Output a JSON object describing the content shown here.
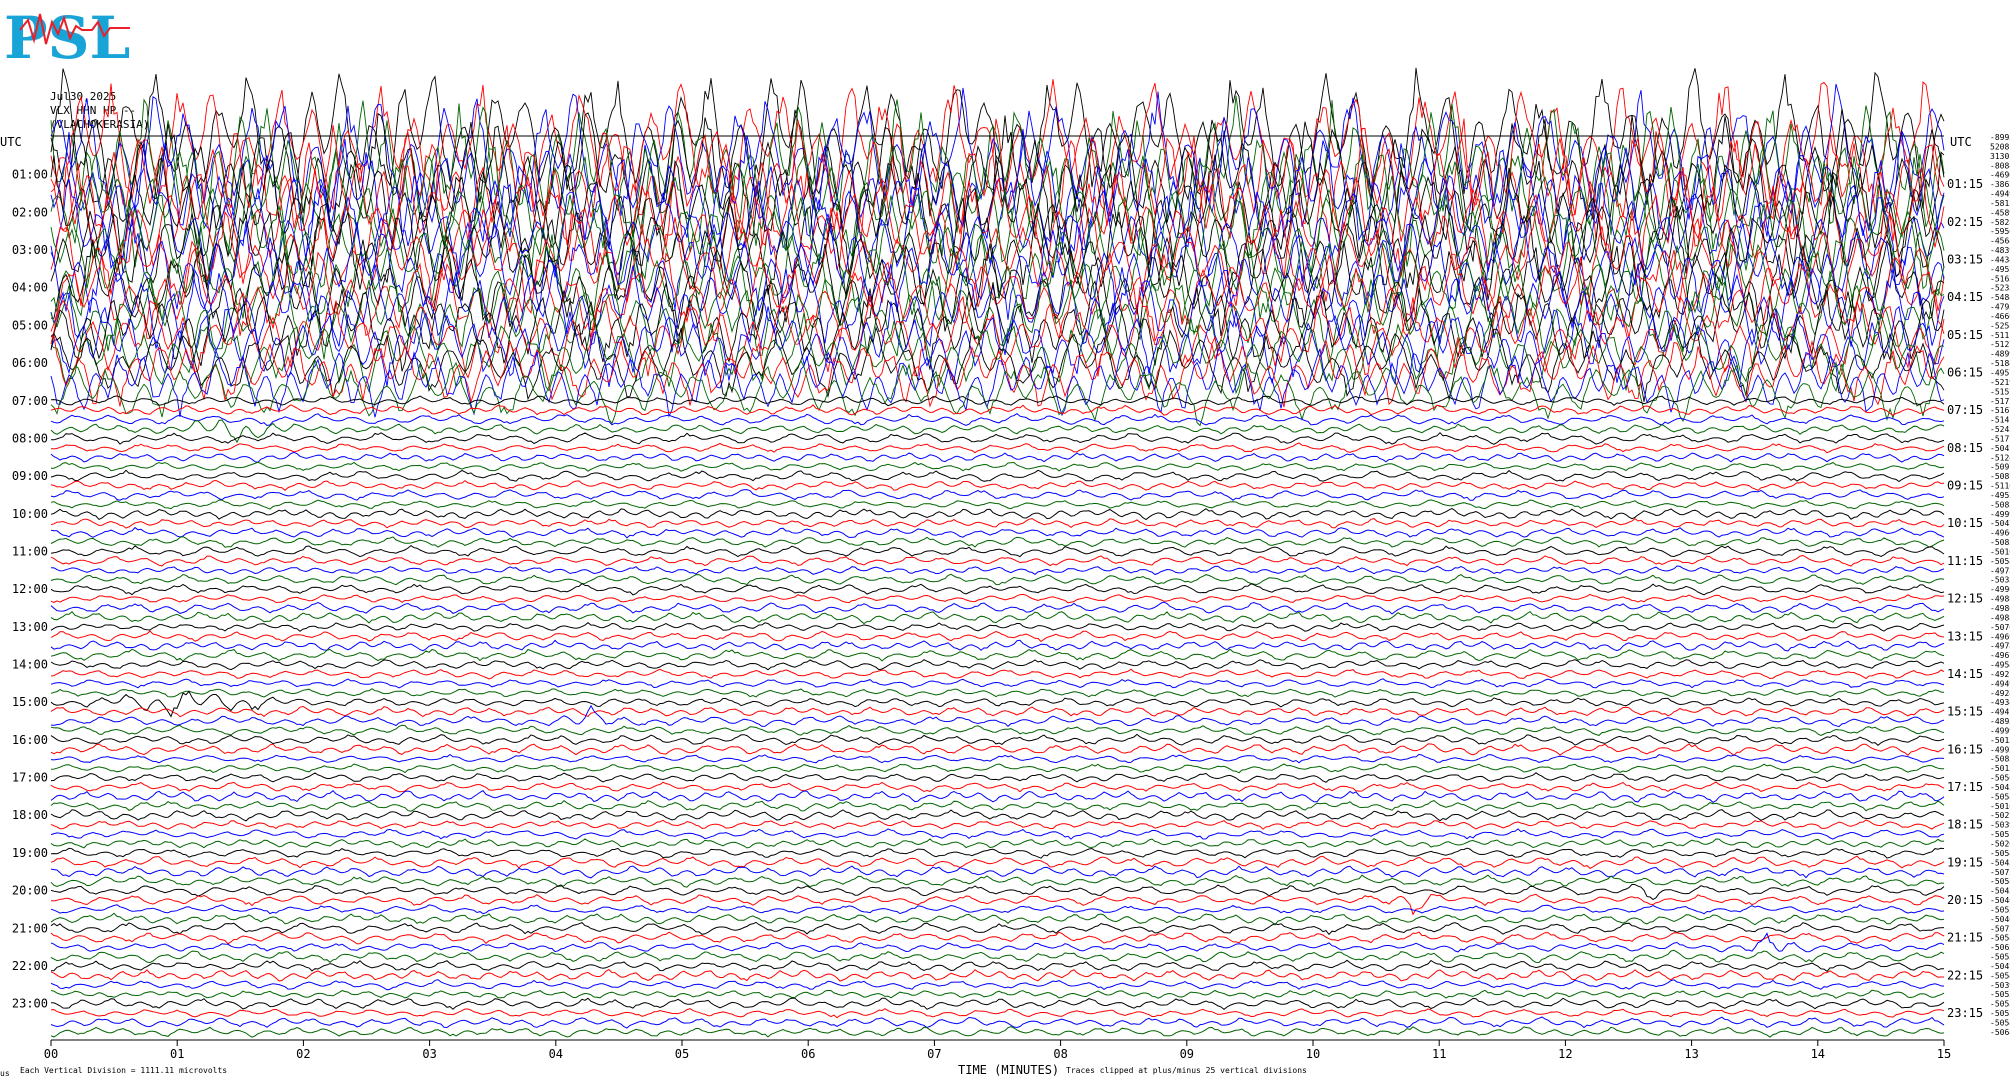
{
  "header": {
    "logo_text": "PSL",
    "date": "Jul30,2025",
    "channel": "VLX HHN HP --",
    "station": "(VLACHOKERASIA)"
  },
  "axis": {
    "left_title": "UTC",
    "right_title": "UTC",
    "x_title": "TIME (MINUTES)",
    "scale_note": "Each Vertical Division = 1111.11 microvolts",
    "clip_note": "Traces clipped at plus/minus 25 vertical divisions",
    "corner_mark": "us"
  },
  "colors": {
    "trace_cycle": [
      "#000000",
      "#ff0000",
      "#0000ff",
      "#006400"
    ],
    "logo_cyan": "#19a4d8",
    "logo_red": "#e8202a"
  },
  "chart_data": {
    "type": "line",
    "title": "",
    "xlabel": "TIME (MINUTES)",
    "x_ticks": [
      "00",
      "01",
      "02",
      "03",
      "04",
      "05",
      "06",
      "07",
      "08",
      "09",
      "10",
      "11",
      "12",
      "13",
      "14",
      "15"
    ],
    "xlim": [
      0,
      15
    ],
    "left_ticks": [
      "01:00",
      "02:00",
      "03:00",
      "04:00",
      "05:00",
      "06:00",
      "07:00",
      "08:00",
      "09:00",
      "10:00",
      "11:00",
      "12:00",
      "13:00",
      "14:00",
      "15:00",
      "16:00",
      "17:00",
      "18:00",
      "19:00",
      "20:00",
      "21:00",
      "22:00",
      "23:00"
    ],
    "right_ticks": [
      "01:15",
      "02:15",
      "03:15",
      "04:15",
      "05:15",
      "06:15",
      "07:15",
      "08:15",
      "09:15",
      "10:15",
      "11:15",
      "12:15",
      "13:15",
      "14:15",
      "15:15",
      "16:15",
      "17:15",
      "18:15",
      "19:15",
      "20:15",
      "21:15",
      "22:15",
      "23:15"
    ],
    "trace_count": 96,
    "trace_minutes": 15,
    "clipped_rows": "00:00-06:45",
    "right_values": [
      "-8995",
      "5208",
      "3130",
      "-8084",
      "-4696",
      "-3862",
      "-4949",
      "-5812",
      "-4589",
      "-5828",
      "-5950",
      "-4564",
      "-4839",
      "-4434",
      "-4952",
      "-5163",
      "-5233",
      "-5484",
      "-4793",
      "-4660",
      "-5255",
      "-5111",
      "-5127",
      "-4899",
      "-5184",
      "-4957",
      "-5219",
      "-5157",
      "-5172",
      "-5167",
      "-5141",
      "-5245",
      "-5177",
      "-5047",
      "-5124",
      "-5097",
      "-5087",
      "-5116",
      "-4952",
      "-5082",
      "-4999",
      "-5047",
      "-4960",
      "-5085",
      "-5010",
      "-5058",
      "-4975",
      "-5033",
      "-4996",
      "-4988",
      "-4986",
      "-4988",
      "-5076",
      "-4969",
      "-4978",
      "-4967",
      "-4954",
      "-4921",
      "-4949",
      "-4924",
      "-4934",
      "-4941",
      "-4895",
      "-4999",
      "-5013",
      "-4992",
      "-5085",
      "-5013",
      "-5056",
      "-5045",
      "-5058",
      "-5010",
      "-5027",
      "-5039",
      "-5051",
      "-5026",
      "-5054",
      "-5043",
      "-5075",
      "-5058",
      "-5043",
      "-5040",
      "-5052",
      "-5046",
      "-5075",
      "-5058",
      "-5063",
      "-5053",
      "-5047",
      "-5054",
      "-5039",
      "-5055",
      "-5053",
      "-5052",
      "-5058",
      "-5068"
    ],
    "events": [
      {
        "minute_start": 1.0,
        "minute_end": 2.0,
        "row_time": "07:45",
        "color": "green",
        "label": ""
      },
      {
        "minute_start": 0.2,
        "minute_end": 2.0,
        "row_time": "15:00",
        "color": "black",
        "label": ""
      },
      {
        "minute_start": 4.0,
        "minute_end": 4.6,
        "row_time": "15:30",
        "color": "green",
        "label": ""
      },
      {
        "minute_start": 12.5,
        "minute_end": 12.8,
        "row_time": "20:00",
        "color": "black",
        "label": ""
      },
      {
        "minute_start": 10.5,
        "minute_end": 11.1,
        "row_time": "20:15",
        "color": "red",
        "label": ""
      },
      {
        "minute_start": 13.3,
        "minute_end": 14.0,
        "row_time": "21:30",
        "color": "blue",
        "label": ""
      }
    ]
  }
}
